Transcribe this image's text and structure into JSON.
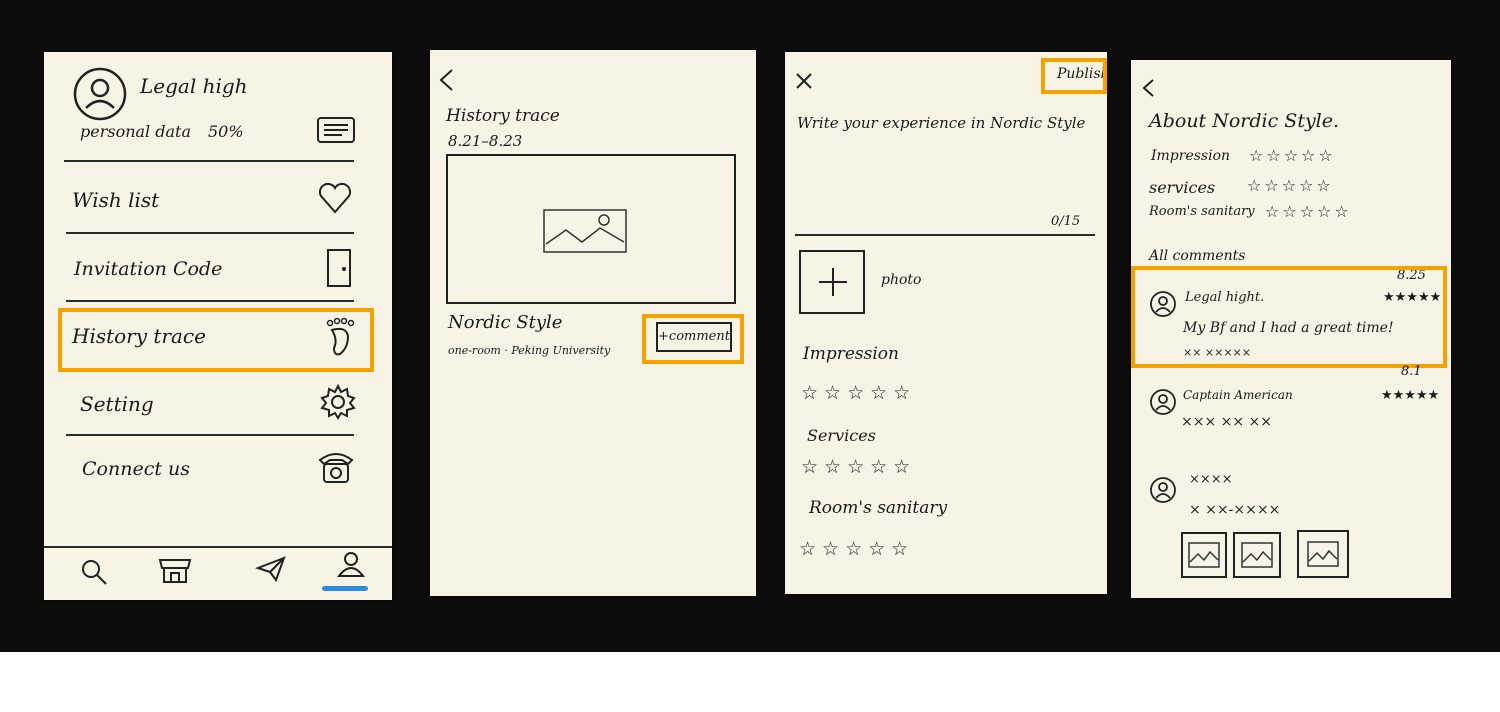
{
  "profile_screen": {
    "user_name": "Legal high",
    "personal_data_label": "personal data",
    "personal_data_percent": "50%",
    "menu": {
      "wish_list": "Wish list",
      "invitation_code": "Invitation Code",
      "history_trace": "History trace",
      "setting": "Setting",
      "connect_us": "Connect us"
    },
    "icons": [
      "avatar-icon",
      "id-card-icon",
      "heart-icon",
      "door-icon",
      "footprint-icon",
      "gear-icon",
      "telephone-icon",
      "search-icon",
      "store-icon",
      "send-icon",
      "profile-icon"
    ],
    "active_tab_color": "#2a8de0"
  },
  "history_screen": {
    "title": "History trace",
    "date_range": "8.21–8.23",
    "place_name": "Nordic Style",
    "place_detail": "one-room · Peking University",
    "comment_button": "+comment"
  },
  "write_screen": {
    "publish_button": "Publish",
    "prompt": "Write your experience in Nordic Style",
    "char_count": "0/15",
    "photo_label": "photo",
    "impression_label": "Impression",
    "services_label": "Services",
    "sanitary_label": "Room's sanitary",
    "stars": "☆☆☆☆☆"
  },
  "about_screen": {
    "title": "About Nordic Style.",
    "impression_label": "Impression",
    "services_label": "services",
    "sanitary_label": "Room's sanitary",
    "stars": "☆☆☆☆☆",
    "all_comments_label": "All comments",
    "comments": [
      {
        "date": "8.25",
        "user": "Legal hight.",
        "text": "My Bf and I had a great time!",
        "sub": "×× ×××××",
        "stars": "★★★★★"
      },
      {
        "date": "8.1",
        "user": "Captain American",
        "text": "××× ×× ××",
        "stars": "★★★★★"
      },
      {
        "date": "",
        "user": "××××",
        "text": "× ××-××××",
        "stars": ""
      }
    ]
  },
  "highlight_color": "#f5a100"
}
